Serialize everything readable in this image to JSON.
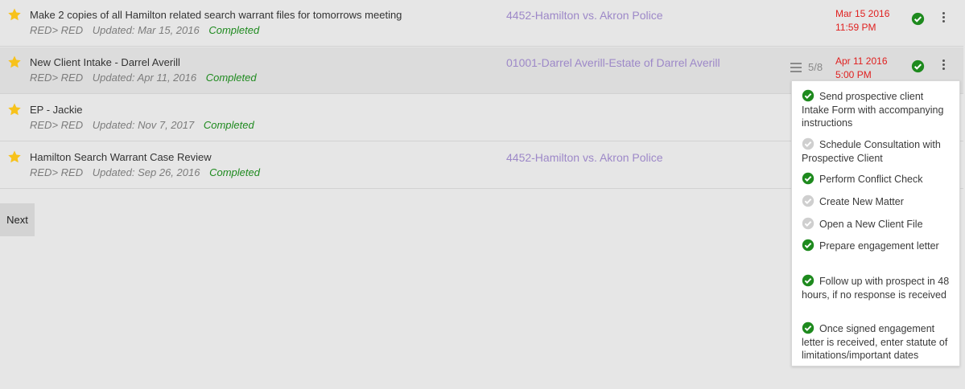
{
  "tasks": [
    {
      "title": "Make 2 copies of all Hamilton related search warrant files for tomorrows meeting",
      "assign": "RED> RED",
      "updated": "Updated: Mar 15, 2016",
      "status": "Completed",
      "matter": "4452-Hamilton vs. Akron Police",
      "due_date": "Mar 15 2016",
      "due_time": "11:59 PM"
    },
    {
      "title": "New Client Intake - Darrel Averill",
      "assign": "RED> RED",
      "updated": "Updated: Apr 11, 2016",
      "status": "Completed",
      "matter": "01001-Darrel Averill-Estate of Darrel Averill",
      "checklist_progress": "5/8",
      "due_date": "Apr 11 2016",
      "due_time": "5:00 PM"
    },
    {
      "title": "EP - Jackie",
      "assign": "RED> RED",
      "updated": "Updated: Nov 7, 2017",
      "status": "Completed"
    },
    {
      "title": "Hamilton Search Warrant Case Review",
      "assign": "RED> RED",
      "updated": "Updated: Sep 26, 2016",
      "status": "Completed",
      "matter": "4452-Hamilton vs. Akron Police"
    }
  ],
  "pagination": {
    "next_label": "Next"
  },
  "checklist": [
    {
      "text": "Send prospective client Intake Form with accompanying instructions",
      "done": true
    },
    {
      "text": "Schedule Consultation with Prospective Client",
      "done": false
    },
    {
      "text": "Perform Conflict Check",
      "done": true
    },
    {
      "text": "Create New Matter",
      "done": false
    },
    {
      "text": "Open a New Client File",
      "done": false
    },
    {
      "text": "Prepare engagement letter",
      "done": true
    },
    {
      "text": "Follow up with prospect in 48 hours, if no response is received",
      "done": true
    },
    {
      "text": "Once signed engagement letter is received, enter statute of limitations/important dates",
      "done": true
    }
  ],
  "colors": {
    "background": "#e6e6e6",
    "star": "#f7c21b",
    "complete_check": "#1e8a1e",
    "incomplete_check": "#cfcfcf",
    "matter_link": "#9d88c8",
    "due_date": "#e0201f",
    "status_text": "#1e8a1e"
  },
  "icons": {
    "star": "star-icon",
    "complete": "check-circle-icon",
    "more": "kebab-menu-icon",
    "checklist": "list-icon"
  }
}
